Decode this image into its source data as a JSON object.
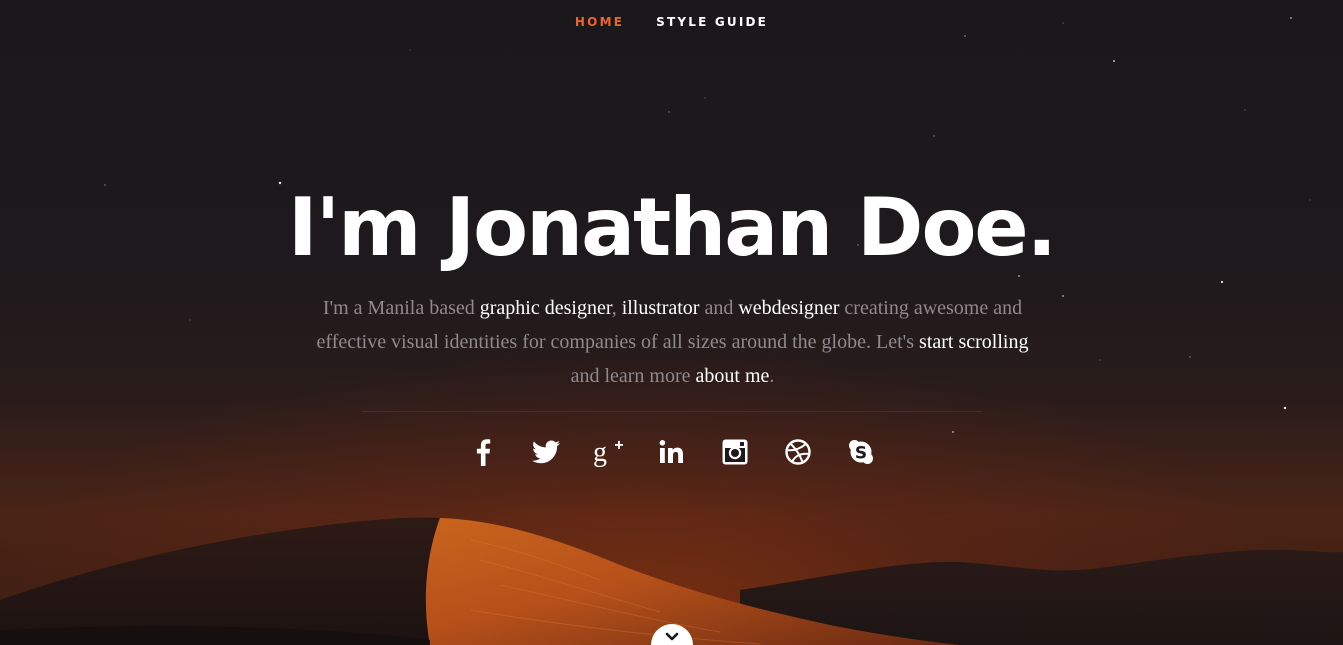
{
  "nav": {
    "items": [
      {
        "label": "HOME",
        "active": true
      },
      {
        "label": "STYLE GUIDE",
        "active": false
      }
    ],
    "active_color": "#f0632d"
  },
  "hero": {
    "headline": "I'm Jonathan Doe.",
    "intro": {
      "part1": "I'm a Manila based ",
      "link1": "graphic designer",
      "part2": ", ",
      "link2": "illustrator",
      "part3": " and ",
      "link3": "webdesigner",
      "part4": " creating awesome and effective visual identities for companies of all sizes around the globe. Let's ",
      "link4": "start scrolling",
      "part5": " and learn more ",
      "link5": "about me",
      "part6": "."
    }
  },
  "social": {
    "icons": [
      "facebook-icon",
      "twitter-icon",
      "google-plus-icon",
      "linkedin-icon",
      "instagram-icon",
      "dribbble-icon",
      "skype-icon"
    ]
  },
  "scroll": {
    "icon": "chevron-down-icon"
  }
}
